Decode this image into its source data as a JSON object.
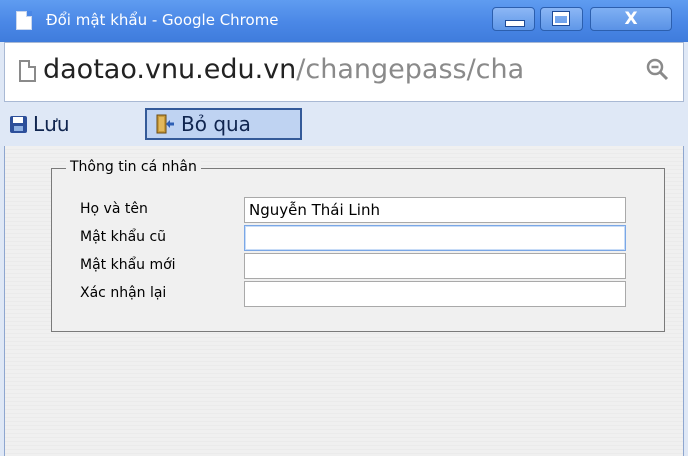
{
  "window": {
    "title": "Đổi mật khẩu - Google Chrome",
    "close_glyph": "X"
  },
  "address_bar": {
    "domain": "daotao.vnu.edu.vn",
    "path": "/changepass/cha"
  },
  "toolbar": {
    "save_label": "Lưu",
    "skip_label": "Bỏ qua"
  },
  "form": {
    "legend": "Thông tin cá nhân",
    "fields": [
      {
        "label": "Họ và tên",
        "value": "Nguyễn Thái Linh"
      },
      {
        "label": "Mật khẩu cũ",
        "value": ""
      },
      {
        "label": "Mật khẩu mới",
        "value": ""
      },
      {
        "label": "Xác nhận lại",
        "value": ""
      }
    ]
  },
  "colors": {
    "titlebar": "#4a87e6",
    "toolbar_bg": "#dfe8f6",
    "content_bg": "#f0f0f0"
  }
}
